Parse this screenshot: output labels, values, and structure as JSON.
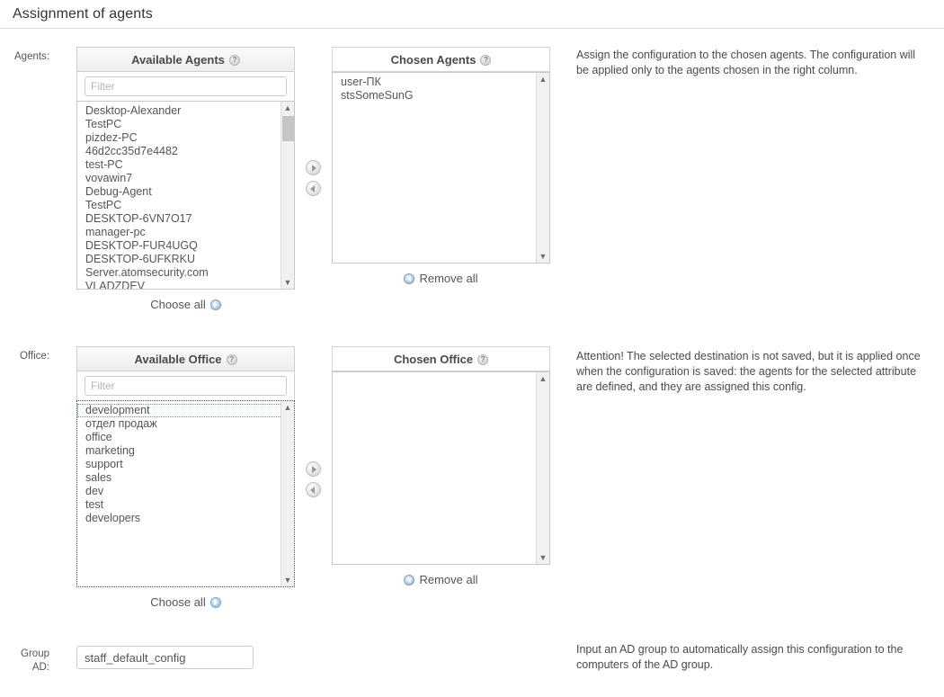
{
  "header": {
    "title": "Assignment of agents"
  },
  "agents_section": {
    "label": "Agents:",
    "available": {
      "title": "Available Agents",
      "help_icon": "question-mark-icon",
      "filter_placeholder": "Filter",
      "filter_value": "",
      "items": [
        "Desktop-Alexander",
        "TestPC",
        "pizdez-PC",
        "46d2cc35d7e4482",
        "test-PC",
        "vovawin7",
        "Debug-Agent",
        "TestPC",
        "DESKTOP-6VN7O17",
        "manager-pc",
        "DESKTOP-FUR4UGQ",
        "DESKTOP-6UFKRKU",
        "Server.atomsecurity.com",
        "VLADZDEV"
      ]
    },
    "chosen": {
      "title": "Chosen Agents",
      "help_icon": "question-mark-icon",
      "items": [
        "user-ПК",
        "stsSomeSunG"
      ]
    },
    "add_button_icon": "arrow-right-circle-icon",
    "remove_button_icon": "arrow-left-circle-icon",
    "choose_all_label": "Choose all",
    "remove_all_label": "Remove all",
    "hint": "Assign the configuration to the chosen agents. The configuration will be applied only to the agents chosen in the right column."
  },
  "office_section": {
    "label": "Office:",
    "available": {
      "title": "Available Office",
      "help_icon": "question-mark-icon",
      "filter_placeholder": "Filter",
      "filter_value": "",
      "items": [
        "development",
        "отдел продаж",
        "office",
        "marketing",
        "support",
        "sales",
        "dev",
        "test",
        "developers"
      ],
      "focused_item_index": 0
    },
    "chosen": {
      "title": "Chosen Office",
      "help_icon": "question-mark-icon",
      "items": []
    },
    "add_button_icon": "arrow-right-circle-icon",
    "remove_button_icon": "arrow-left-circle-icon",
    "choose_all_label": "Choose all",
    "remove_all_label": "Remove all",
    "hint": "Attention! The selected destination is not saved, but it is applied once when the configuration is saved: the agents for the selected attribute are defined, and they are assigned this config."
  },
  "group_ad": {
    "label_line1": "Group",
    "label_line2": "AD:",
    "value": "staff_default_config",
    "placeholder": "",
    "hint": "Input an AD group to automatically assign this configuration to the computers of the AD group."
  },
  "colors": {
    "accent_blue": "#7ea8d6",
    "text": "#555555",
    "border": "#cccccc",
    "panel_head_bg": "#ededed"
  }
}
